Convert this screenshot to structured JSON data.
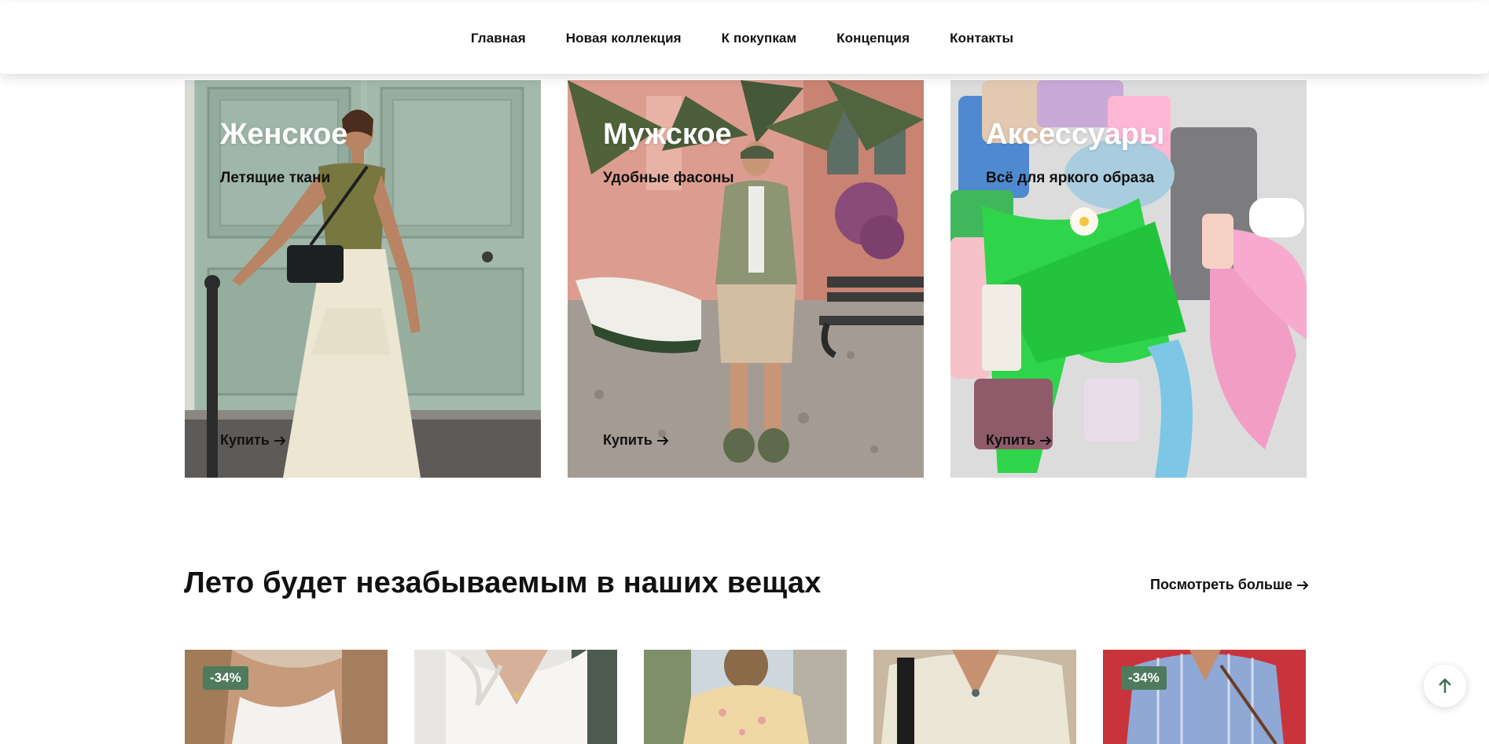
{
  "nav": {
    "items": [
      {
        "label": "Главная"
      },
      {
        "label": "Новая коллекция"
      },
      {
        "label": "К покупкам"
      },
      {
        "label": "Концепция"
      },
      {
        "label": "Контакты"
      }
    ]
  },
  "categories": [
    {
      "title": "Женское",
      "subtitle": "Летящие ткани",
      "buy_label": "Купить",
      "arrow_icon": "arrow-right-icon"
    },
    {
      "title": "Мужское",
      "subtitle": "Удобные фасоны",
      "buy_label": "Купить",
      "arrow_icon": "arrow-right-icon"
    },
    {
      "title": "Аксессуары",
      "subtitle": "Всё для яркого образа",
      "buy_label": "Купить",
      "arrow_icon": "arrow-right-icon"
    }
  ],
  "section": {
    "title": "Лето будет незабываемым в наших вещах",
    "see_more": "Посмотреть больше"
  },
  "products": [
    {
      "badge": "-34%"
    },
    {
      "badge": ""
    },
    {
      "badge": ""
    },
    {
      "badge": ""
    },
    {
      "badge": "-34%"
    }
  ],
  "colors": {
    "badge_bg": "#4f7a5d",
    "title_on_image": "#ffffff",
    "text": "#111111"
  },
  "icons": {
    "scroll_top": "arrow-up-icon",
    "link_arrow": "arrow-right-icon"
  }
}
